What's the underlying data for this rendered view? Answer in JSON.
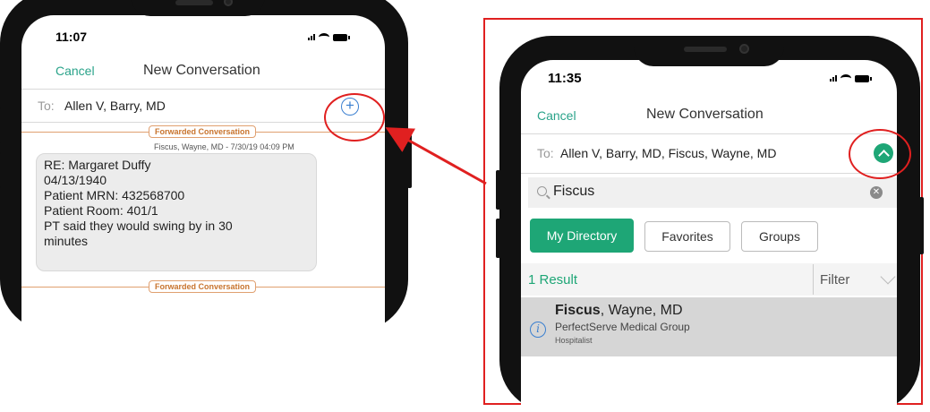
{
  "left_phone": {
    "time": "11:07",
    "cancel": "Cancel",
    "title": "New Conversation",
    "to_label": "To:",
    "to_value": "Allen V, Barry, MD",
    "add_icon": "plus-circle-icon",
    "forward_label": "Forwarded Conversation",
    "forward_meta": "Fiscus, Wayne, MD - 7/30/19 04:09 PM",
    "message_lines": [
      "RE: Margaret Duffy",
      "04/13/1940",
      "Patient MRN: 432568700",
      "Patient Room: 401/1",
      "PT said they would swing by in 30",
      "minutes"
    ],
    "forward_label_end": "Forwarded Conversation"
  },
  "right_phone": {
    "time": "11:35",
    "cancel": "Cancel",
    "title": "New Conversation",
    "to_label": "To:",
    "to_value": "Allen V, Barry, MD, Fiscus, Wayne, MD",
    "collapse_icon": "chevron-up-circle-icon",
    "search_value": "Fiscus",
    "segments": [
      "My Directory",
      "Favorites",
      "Groups"
    ],
    "active_segment": "My Directory",
    "results_count": "1 Result",
    "filter_label": "Filter",
    "result": {
      "name_bold": "Fiscus",
      "name_rest": ", Wayne, MD",
      "org": "PerfectServe Medical Group",
      "role": "Hospitalist"
    }
  },
  "colors": {
    "accent_green": "#1ea676",
    "highlight_red": "#e02020",
    "forward_orange": "#c8742e",
    "link_blue": "#3a7fd0"
  }
}
